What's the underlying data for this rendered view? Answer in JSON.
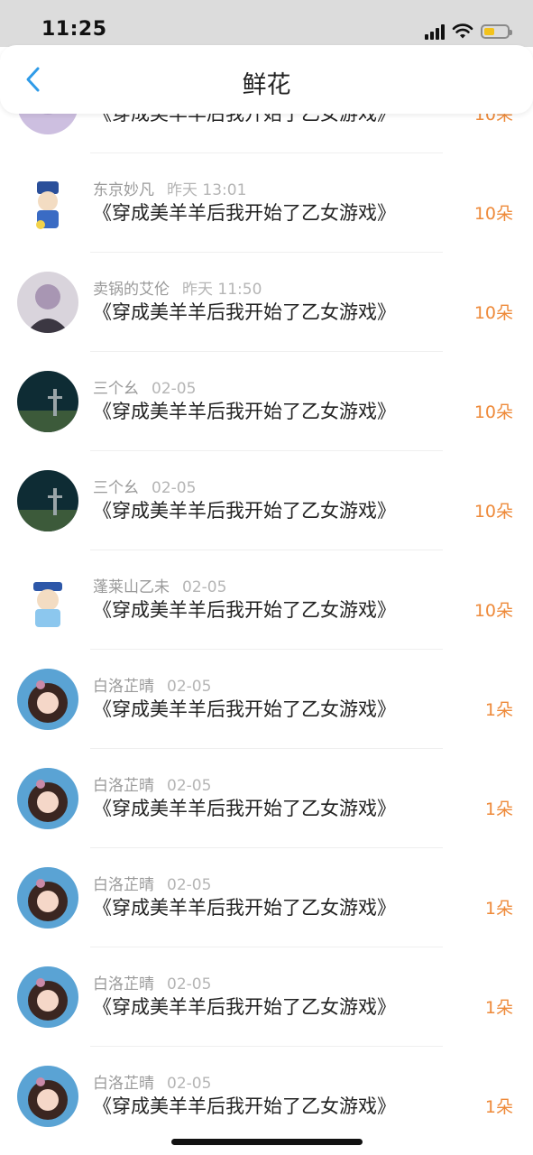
{
  "status_bar": {
    "time": "11:25"
  },
  "nav": {
    "title": "鲜花"
  },
  "items": [
    {
      "user": "",
      "time": "",
      "book": "《穿成美羊羊后我开始了乙女游戏》",
      "count": "10朵"
    },
    {
      "user": "东京妙凡",
      "time": "昨天 13:01",
      "book": "《穿成美羊羊后我开始了乙女游戏》",
      "count": "10朵"
    },
    {
      "user": "卖锅的艾伦",
      "time": "昨天 11:50",
      "book": "《穿成美羊羊后我开始了乙女游戏》",
      "count": "10朵"
    },
    {
      "user": "三个幺",
      "time": "02-05",
      "book": "《穿成美羊羊后我开始了乙女游戏》",
      "count": "10朵"
    },
    {
      "user": "三个幺",
      "time": "02-05",
      "book": "《穿成美羊羊后我开始了乙女游戏》",
      "count": "10朵"
    },
    {
      "user": "蓬莱山乙未",
      "time": "02-05",
      "book": "《穿成美羊羊后我开始了乙女游戏》",
      "count": "10朵"
    },
    {
      "user": "白洛芷晴",
      "time": "02-05",
      "book": "《穿成美羊羊后我开始了乙女游戏》",
      "count": "1朵"
    },
    {
      "user": "白洛芷晴",
      "time": "02-05",
      "book": "《穿成美羊羊后我开始了乙女游戏》",
      "count": "1朵"
    },
    {
      "user": "白洛芷晴",
      "time": "02-05",
      "book": "《穿成美羊羊后我开始了乙女游戏》",
      "count": "1朵"
    },
    {
      "user": "白洛芷晴",
      "time": "02-05",
      "book": "《穿成美羊羊后我开始了乙女游戏》",
      "count": "1朵"
    },
    {
      "user": "白洛芷晴",
      "time": "02-05",
      "book": "《穿成美羊羊后我开始了乙女游戏》",
      "count": "1朵"
    }
  ],
  "colors": {
    "accent": "#ee8a3a",
    "back": "#2f9be8"
  }
}
